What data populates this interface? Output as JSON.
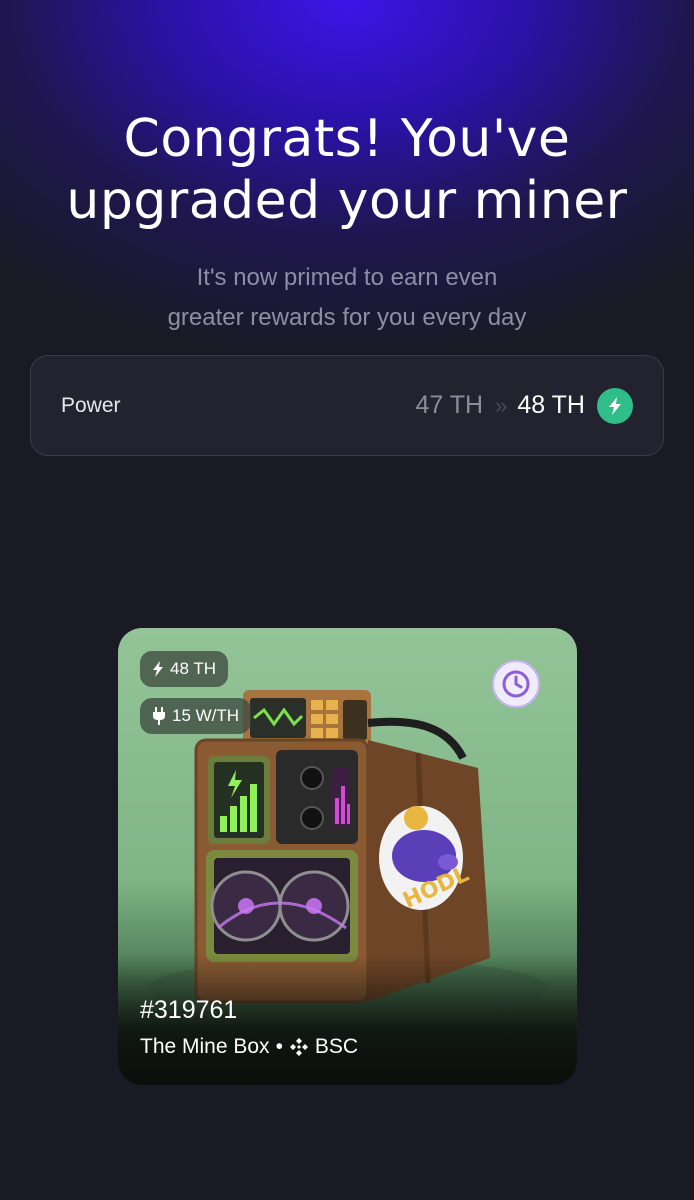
{
  "headline": {
    "line1": "Congrats! You've",
    "line2": "upgraded your miner"
  },
  "subtitle": {
    "line1": "It's now primed to earn even",
    "line2": "greater rewards for you every day"
  },
  "power": {
    "label": "Power",
    "old_value": "47 TH",
    "arrow": "»",
    "new_value": "48 TH"
  },
  "nft": {
    "hashrate_chip": "48 TH",
    "efficiency_chip": "15 W/TH",
    "token_id": "#319761",
    "collection": "The Mine Box",
    "separator": "•",
    "chain": "BSC",
    "sticker_text": "HODL"
  },
  "colors": {
    "accent_green": "#2fbd8a",
    "background": "#191a24",
    "glow_purple": "#3d14e8"
  }
}
